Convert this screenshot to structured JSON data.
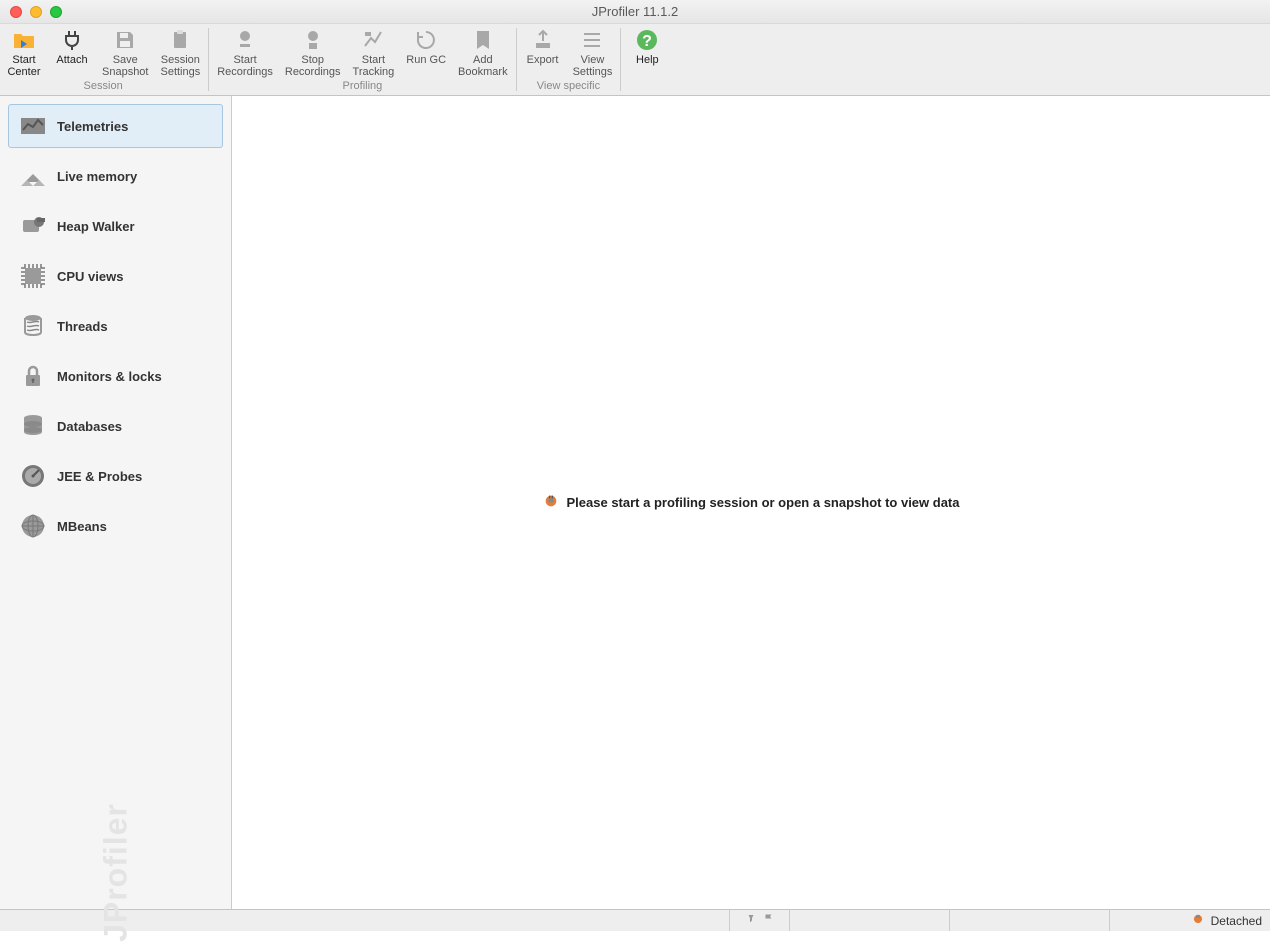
{
  "window": {
    "title": "JProfiler 11.1.2"
  },
  "toolbar": {
    "groups": [
      {
        "label": "Session",
        "buttons": [
          {
            "id": "start-center",
            "label": "Start\nCenter",
            "enabled": true,
            "icon": "folder-play"
          },
          {
            "id": "attach",
            "label": "Attach",
            "enabled": true,
            "icon": "plug"
          },
          {
            "id": "save-snapshot",
            "label": "Save\nSnapshot",
            "enabled": false,
            "icon": "save"
          },
          {
            "id": "session-settings",
            "label": "Session\nSettings",
            "enabled": false,
            "icon": "clipboard"
          }
        ]
      },
      {
        "label": "Profiling",
        "buttons": [
          {
            "id": "start-recordings",
            "label": "Start\nRecordings",
            "enabled": false,
            "icon": "record-start"
          },
          {
            "id": "stop-recordings",
            "label": "Stop\nRecordings",
            "enabled": false,
            "icon": "record-stop"
          },
          {
            "id": "start-tracking",
            "label": "Start\nTracking",
            "enabled": false,
            "icon": "tracking"
          },
          {
            "id": "run-gc",
            "label": "Run GC",
            "enabled": false,
            "icon": "gc"
          },
          {
            "id": "add-bookmark",
            "label": "Add\nBookmark",
            "enabled": false,
            "icon": "bookmark"
          }
        ]
      },
      {
        "label": "View specific",
        "buttons": [
          {
            "id": "export",
            "label": "Export",
            "enabled": false,
            "icon": "export"
          },
          {
            "id": "view-settings",
            "label": "View\nSettings",
            "enabled": false,
            "icon": "list"
          }
        ]
      },
      {
        "label": "",
        "buttons": [
          {
            "id": "help",
            "label": "Help",
            "enabled": true,
            "icon": "help"
          }
        ]
      }
    ]
  },
  "sidebar": {
    "brand": "JProfiler",
    "items": [
      {
        "id": "telemetries",
        "label": "Telemetries",
        "icon": "telemetries",
        "selected": true
      },
      {
        "id": "live-memory",
        "label": "Live memory",
        "icon": "live-memory",
        "selected": false
      },
      {
        "id": "heap-walker",
        "label": "Heap Walker",
        "icon": "heap-walker",
        "selected": false
      },
      {
        "id": "cpu-views",
        "label": "CPU views",
        "icon": "cpu",
        "selected": false
      },
      {
        "id": "threads",
        "label": "Threads",
        "icon": "threads",
        "selected": false
      },
      {
        "id": "monitors-locks",
        "label": "Monitors & locks",
        "icon": "lock",
        "selected": false
      },
      {
        "id": "databases",
        "label": "Databases",
        "icon": "database",
        "selected": false
      },
      {
        "id": "jee-probes",
        "label": "JEE & Probes",
        "icon": "probe",
        "selected": false
      },
      {
        "id": "mbeans",
        "label": "MBeans",
        "icon": "globe",
        "selected": false
      }
    ]
  },
  "main": {
    "message": "Please start a profiling session or open a snapshot to view data"
  },
  "statusbar": {
    "detached": "Detached"
  }
}
